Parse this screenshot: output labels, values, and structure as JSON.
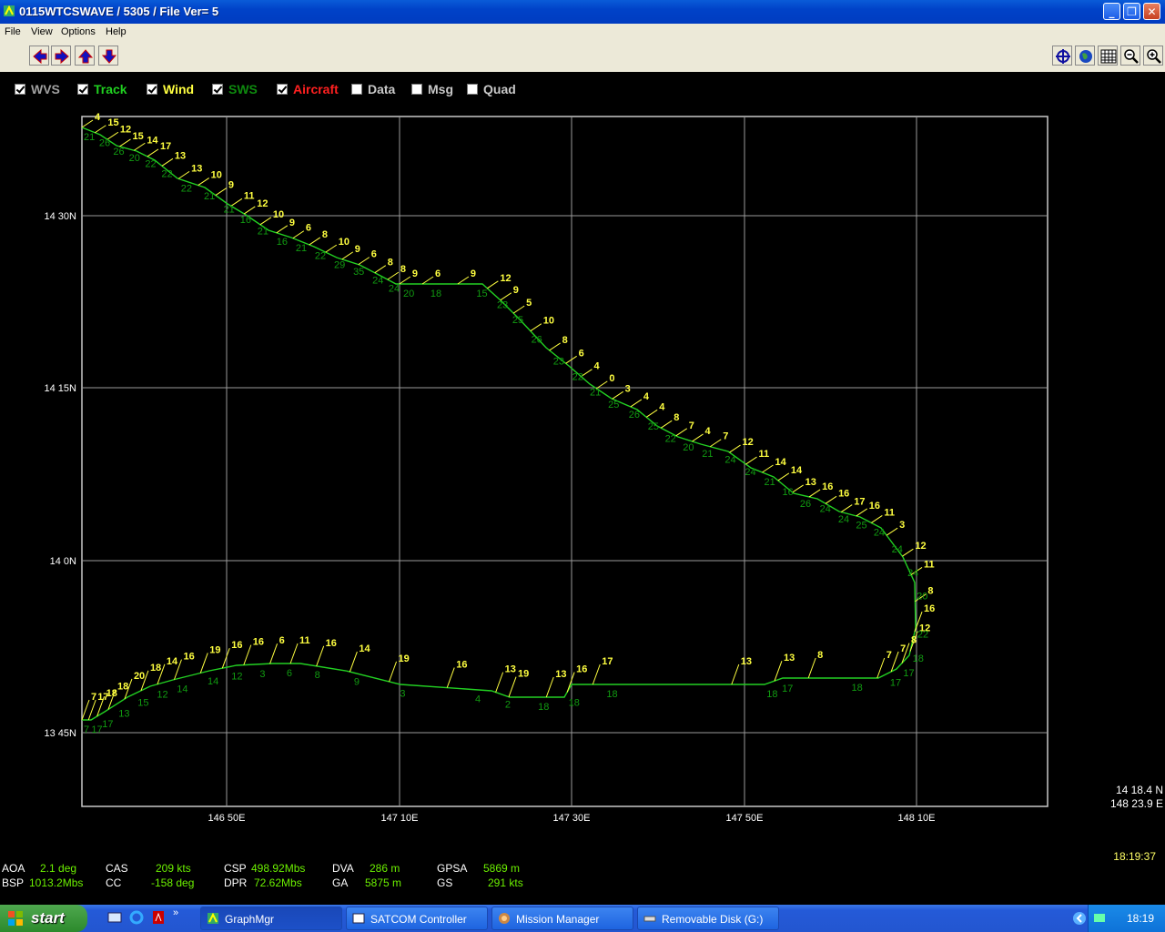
{
  "window": {
    "title": "0115WTCSWAVE / 5305 / File Ver= 5"
  },
  "menu": [
    "File",
    "View",
    "Options",
    "Help"
  ],
  "toolbar": {
    "left": [
      "arrow-left-icon",
      "arrow-right-icon",
      "arrow-up-icon",
      "arrow-down-icon"
    ],
    "right": [
      "crosshair-icon",
      "globe-icon",
      "grid-icon",
      "zoom-out-icon",
      "zoom-in-icon"
    ]
  },
  "layers": [
    {
      "label": "WVS",
      "checked": true,
      "color": "#a0a0a0"
    },
    {
      "label": "Track",
      "checked": true,
      "color": "#20d020"
    },
    {
      "label": "Wind",
      "checked": true,
      "color": "#ffff40"
    },
    {
      "label": "SWS",
      "checked": true,
      "color": "#0e8a0e"
    },
    {
      "label": "Aircraft",
      "checked": true,
      "color": "#ff2020"
    },
    {
      "label": "Data",
      "checked": false,
      "color": "#c8c8c8"
    },
    {
      "label": "Msg",
      "checked": false,
      "color": "#c8c8c8"
    },
    {
      "label": "Quad",
      "checked": false,
      "color": "#c8c8c8"
    }
  ],
  "plot": {
    "lat_labels": [
      "14 30N",
      "14 15N",
      "14 0N",
      "13 45N"
    ],
    "lon_labels": [
      "146 50E",
      "147 10E",
      "147 30E",
      "147 50E",
      "148 10E"
    ],
    "cursor_readout": {
      "lat": "14 18.4 N",
      "lon": "148 23.9 E"
    },
    "colors": {
      "track": "#22d022",
      "wind": "#ffff40",
      "sws": "#119a11",
      "grid": "#9a9a9a",
      "frame": "#c8c8c8"
    },
    "wind_labels": [
      "4",
      "15",
      "12",
      "15",
      "14",
      "17",
      "13",
      "13",
      "10",
      "9",
      "11",
      "12",
      "10",
      "9",
      "6",
      "8",
      "10",
      "9",
      "6",
      "8",
      "8",
      "9",
      "6",
      "9",
      "12",
      "9",
      "5",
      "10",
      "8",
      "6",
      "4",
      "0",
      "3",
      "4",
      "4",
      "8",
      "7",
      "4",
      "7",
      "12",
      "11",
      "14",
      "14",
      "13",
      "16",
      "16",
      "17",
      "16",
      "11",
      "3",
      "12",
      "11",
      "8",
      "16",
      "12",
      "8",
      "7",
      "7",
      "8",
      "13",
      "13",
      "17",
      "16",
      "13",
      "19",
      "13",
      "16",
      "19",
      "14",
      "16",
      "11",
      "6",
      "16",
      "16",
      "19",
      "16",
      "14",
      "18",
      "20",
      "18",
      "18",
      "17",
      "7"
    ],
    "sws_labels": [
      "21",
      "26",
      "26",
      "20",
      "22",
      "22",
      "22",
      "21",
      "21",
      "16",
      "21",
      "16",
      "21",
      "22",
      "29",
      "35",
      "24",
      "24",
      "20",
      "18",
      "15",
      "23",
      "25",
      "26",
      "23",
      "22",
      "21",
      "25",
      "26",
      "25",
      "22",
      "20",
      "21",
      "24",
      "24",
      "21",
      "16",
      "26",
      "24",
      "24",
      "25",
      "24",
      "24",
      "24",
      "20",
      "22",
      "18",
      "17",
      "17",
      "18",
      "17",
      "18",
      "18",
      "18",
      "18",
      "2",
      "4",
      "3",
      "9",
      "8",
      "6",
      "3",
      "12",
      "14",
      "14",
      "12",
      "15",
      "13",
      "17",
      "17",
      "7"
    ]
  },
  "status": {
    "AOA": "2.1  deg",
    "CAS": "209 kts",
    "CSP": "498.92Mbs",
    "DVA": "286  m",
    "GPSA": "5869 m",
    "BSP": "1013.2Mbs",
    "CC": "-158 deg",
    "DPR": "72.62Mbs",
    "GA": "5875 m",
    "GS": "291  kts",
    "time": "18:19:37"
  },
  "taskbar": {
    "start": "start",
    "tasks": [
      "GraphMgr",
      "SATCOM Controller",
      "Mission Manager",
      "Removable Disk (G:)"
    ],
    "clock": "18:19"
  }
}
